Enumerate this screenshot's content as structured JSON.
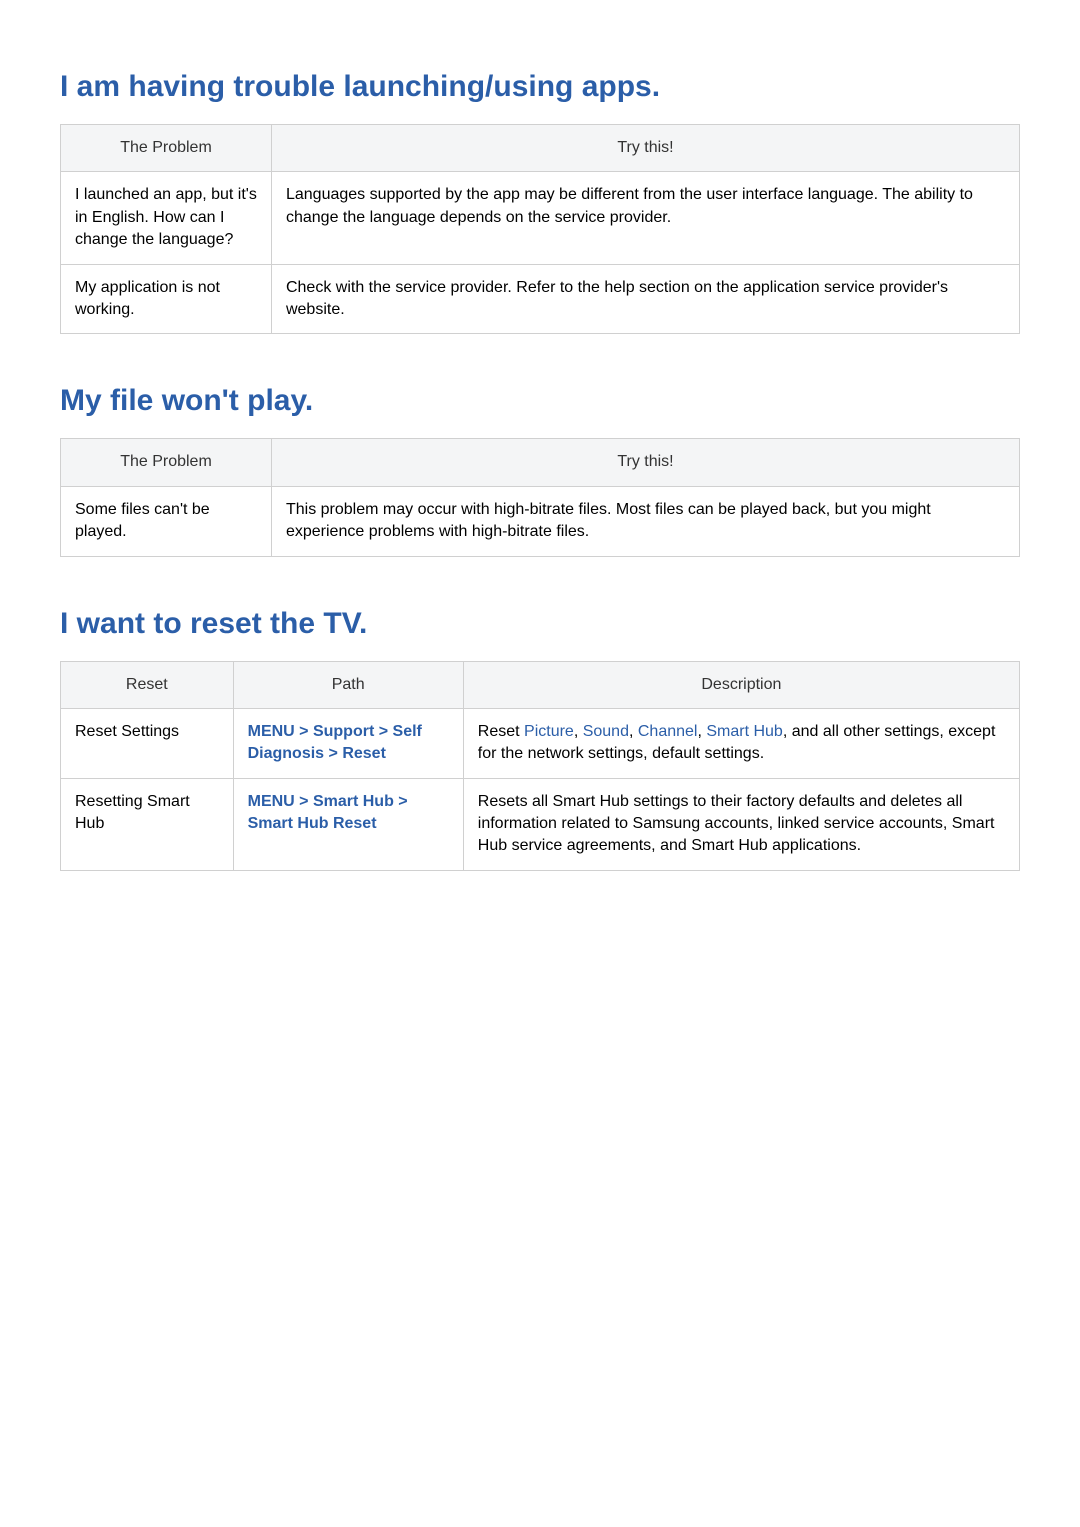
{
  "sections": [
    {
      "heading": "I am having trouble launching/using apps.",
      "headers": [
        "The Problem",
        "Try this!"
      ],
      "rows": [
        {
          "col1": "I launched an app, but it's in English. How can I change the language?",
          "col2": "Languages supported by the app may be different from the user interface language. The ability to change the language depends on the service provider."
        },
        {
          "col1": "My application is not working.",
          "col2": "Check with the service provider.\nRefer to the help section on the application service provider's website."
        }
      ]
    },
    {
      "heading": "My file won't play.",
      "headers": [
        "The Problem",
        "Try this!"
      ],
      "rows": [
        {
          "col1": "Some files can't be played.",
          "col2": "This problem may occur with high-bitrate files. Most files can be played back, but you might experience problems with high-bitrate files."
        }
      ]
    }
  ],
  "reset_section": {
    "heading": "I want to reset the TV.",
    "headers": [
      "Reset",
      "Path",
      "Description"
    ],
    "rows": [
      {
        "reset": "Reset Settings",
        "path_tokens": [
          "MENU",
          ">",
          "Support",
          ">",
          "Self Diagnosis",
          ">",
          "Reset"
        ],
        "desc_prefix": "Reset ",
        "desc_terms": [
          "Picture",
          "Sound",
          "Channel",
          "Smart Hub"
        ],
        "desc_suffix": ", and all other settings, except for the network settings, default settings."
      },
      {
        "reset": "Resetting Smart Hub",
        "path_tokens": [
          "MENU",
          ">",
          "Smart Hub",
          ">",
          "Smart Hub Reset"
        ],
        "desc_plain": "Resets all Smart Hub settings to their factory defaults and deletes all information related to Samsung accounts, linked service accounts, Smart Hub service agreements, and Smart Hub applications."
      }
    ]
  }
}
